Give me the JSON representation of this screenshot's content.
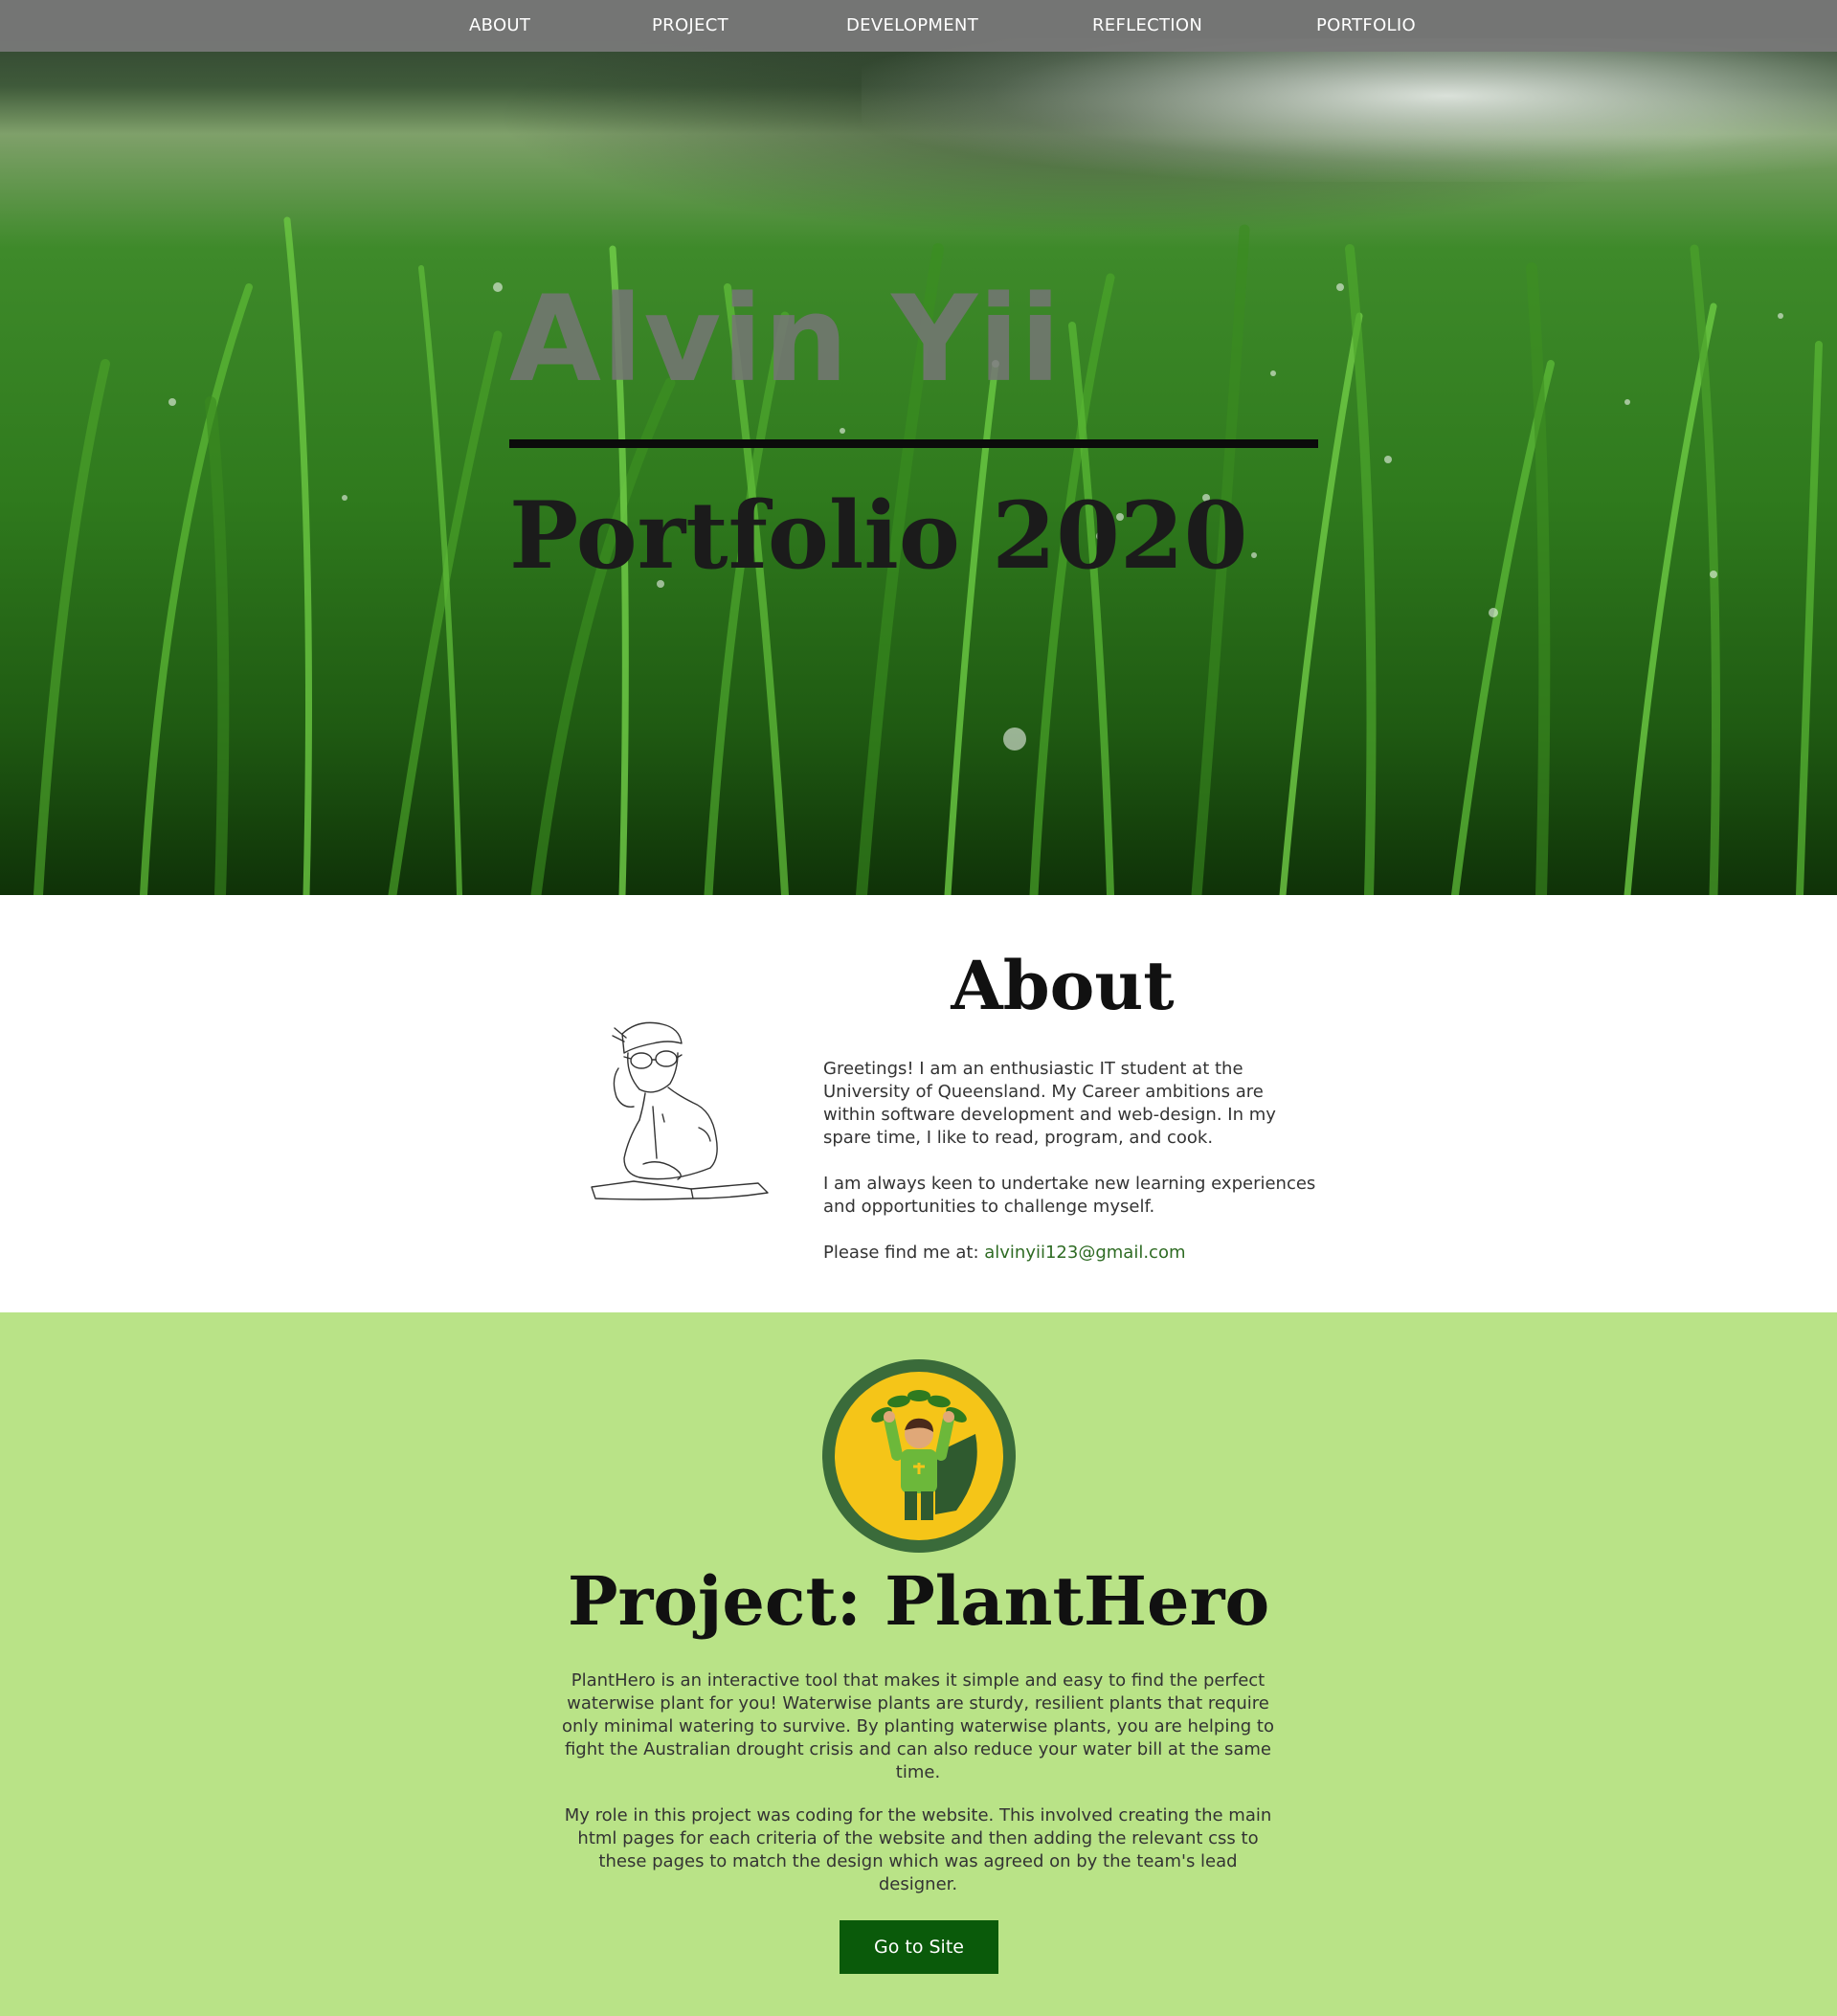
{
  "nav": {
    "items": [
      {
        "label": "ABOUT"
      },
      {
        "label": "PROJECT"
      },
      {
        "label": "DEVELOPMENT"
      },
      {
        "label": "REFLECTION"
      },
      {
        "label": "PORTFOLIO"
      }
    ]
  },
  "hero": {
    "name": "Alvin Yii",
    "subtitle": "Portfolio 2020"
  },
  "about": {
    "title": "About",
    "paragraph1": "Greetings! I am an enthusiastic IT student at the University of Queensland. My Career ambitions are within software development and web-design. In my spare time, I like to read, program, and cook.",
    "paragraph2": "I am always keen to undertake new learning experiences and opportunities to challenge myself.",
    "contact_prefix": "Please find me at: ",
    "email": "alvinyii123@gmail.com"
  },
  "project": {
    "title": "Project: PlantHero",
    "paragraph1": "PlantHero is an interactive tool that makes it simple and easy to find the perfect waterwise plant for you! Waterwise plants are sturdy, resilient plants that require only minimal watering to survive. By planting waterwise plants, you are helping to fight the Australian drought crisis and can also reduce your water bill at the same time.",
    "paragraph2": "My role in this project was coding for the website. This involved creating the main html pages for each criteria of the website and then adding the relevant css to these pages to match the design which was agreed on by the team's lead designer.",
    "button_label": "Go to Site"
  },
  "colors": {
    "nav_bg": "#787878",
    "project_bg": "#b9e387",
    "button_bg": "#0a5a0a",
    "link": "#2e6b23",
    "logo_ring": "#3a6b3a",
    "logo_fill": "#f5c518"
  }
}
